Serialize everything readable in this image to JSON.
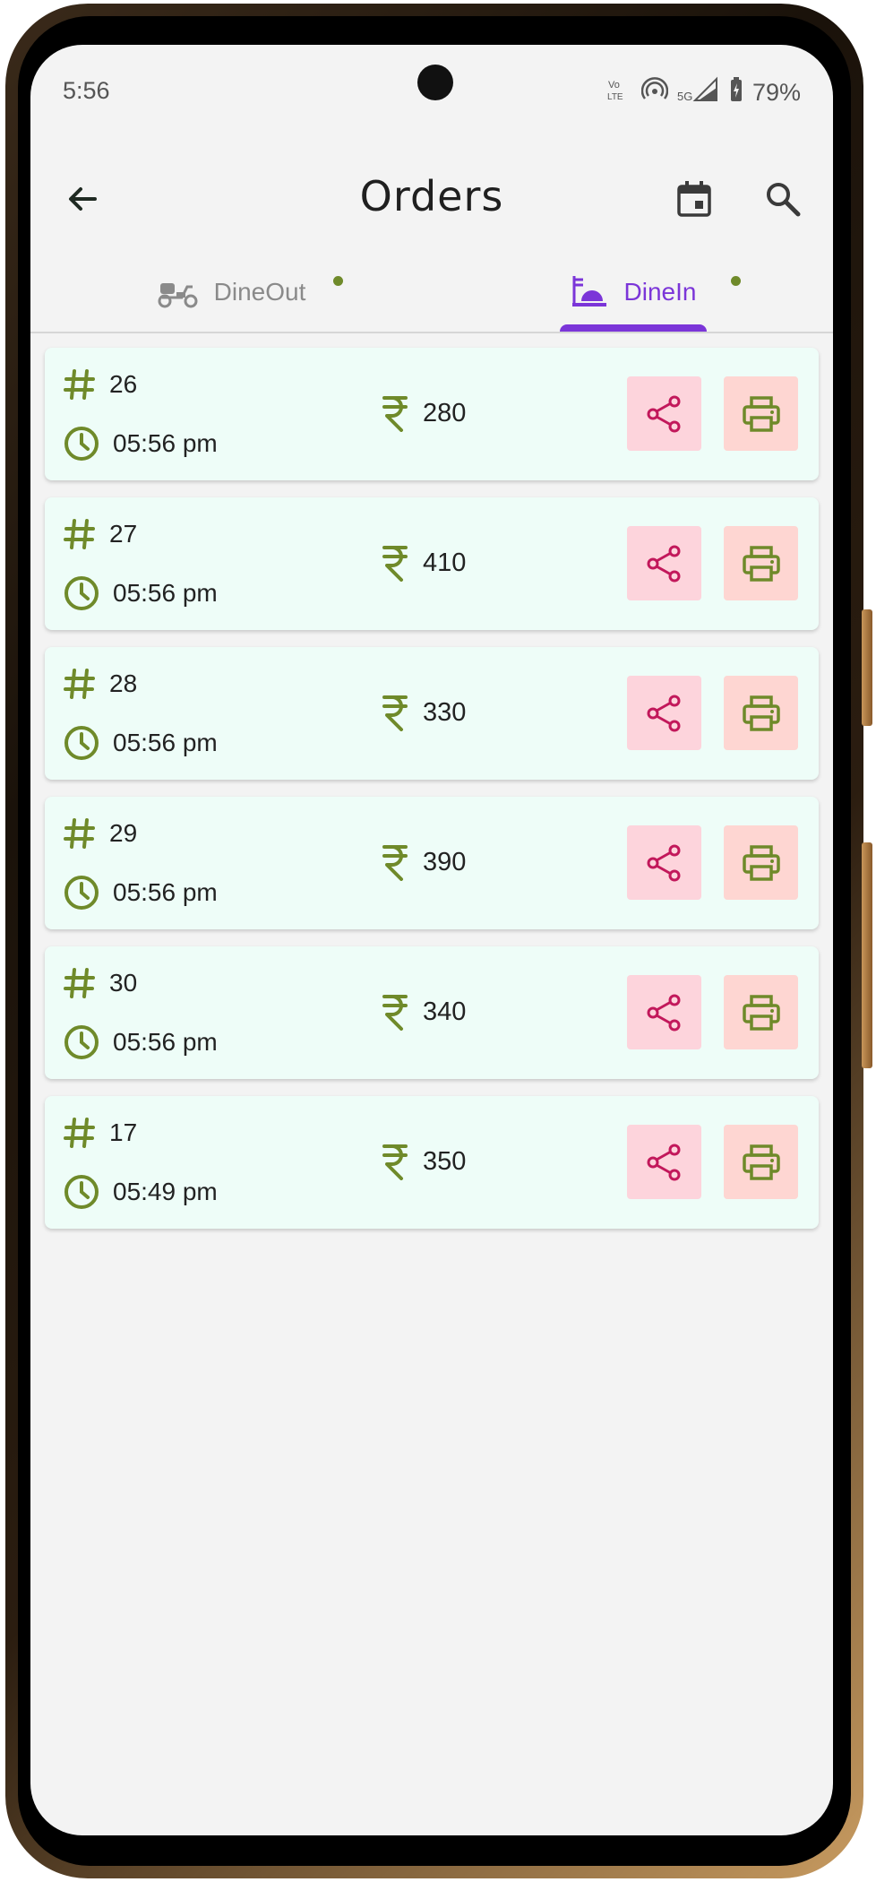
{
  "status_bar": {
    "time": "5:56",
    "battery": "79%"
  },
  "header": {
    "title": "Orders"
  },
  "tabs": [
    {
      "label": "DineOut",
      "icon": "scooter-icon",
      "active": false
    },
    {
      "label": "DineIn",
      "icon": "dine-in-icon",
      "active": true
    }
  ],
  "orders": [
    {
      "number": "26",
      "time": "05:56 pm",
      "amount": "280"
    },
    {
      "number": "27",
      "time": "05:56 pm",
      "amount": "410"
    },
    {
      "number": "28",
      "time": "05:56 pm",
      "amount": "330"
    },
    {
      "number": "29",
      "time": "05:56 pm",
      "amount": "390"
    },
    {
      "number": "30",
      "time": "05:56 pm",
      "amount": "340"
    },
    {
      "number": "17",
      "time": "05:49 pm",
      "amount": "350"
    }
  ],
  "colors": {
    "accent": "#7b35d8",
    "icon_olive": "#6f8a2a",
    "share_icon": "#c2185b",
    "card_bg": "#eefdf8"
  }
}
